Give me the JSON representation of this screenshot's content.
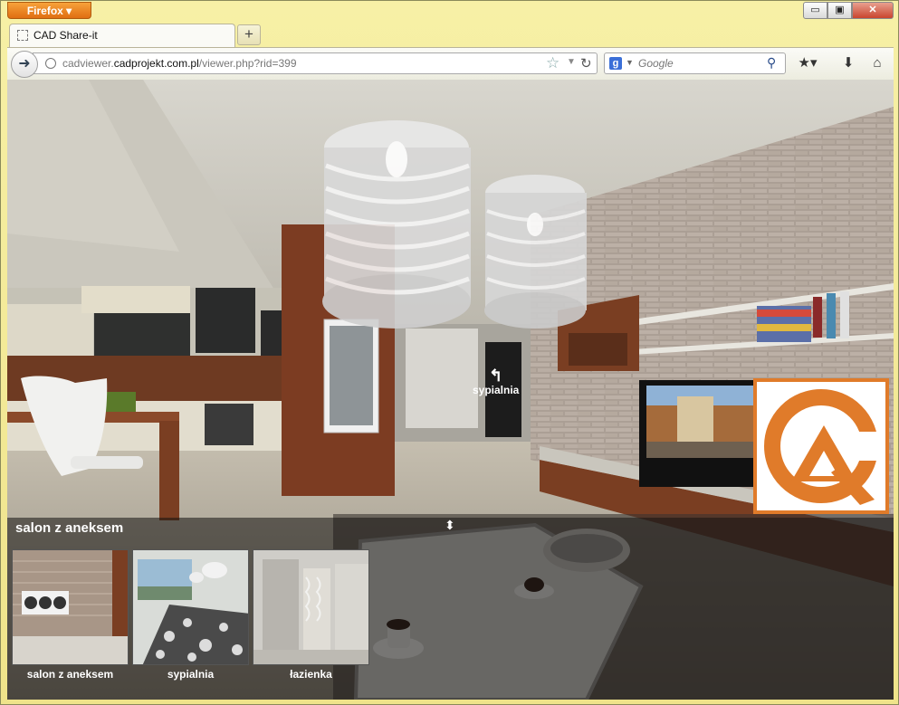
{
  "browser": {
    "app_button": "Firefox",
    "tab_title": "CAD Share-it",
    "new_tab": "+",
    "url_prefix": "cadviewer.",
    "url_domain": "cadprojekt.com.pl",
    "url_path": "/viewer.php?rid=399",
    "search_engine": "g",
    "search_placeholder": "Google",
    "window_controls": {
      "minimize": "▭",
      "maximize": "▣",
      "close": "✕"
    }
  },
  "icons": {
    "back": "arrow-left-icon",
    "site": "globe-icon",
    "bookmark_star": "star-icon",
    "reload": "reload-icon",
    "search": "magnifier-icon",
    "bookmarks": "bookmarks-icon",
    "download": "download-icon",
    "home": "home-icon"
  },
  "viewer": {
    "hotspot_label": "sypialnia",
    "panel_title": "salon z aneksem",
    "thumbnails": [
      {
        "label": "salon z aneksem"
      },
      {
        "label": "sypialnia"
      },
      {
        "label": "łazienka"
      }
    ]
  },
  "colors": {
    "window_frame": "#f0e88a",
    "firefox_orange": "#e8821f",
    "logo_orange": "#e07b2a"
  }
}
